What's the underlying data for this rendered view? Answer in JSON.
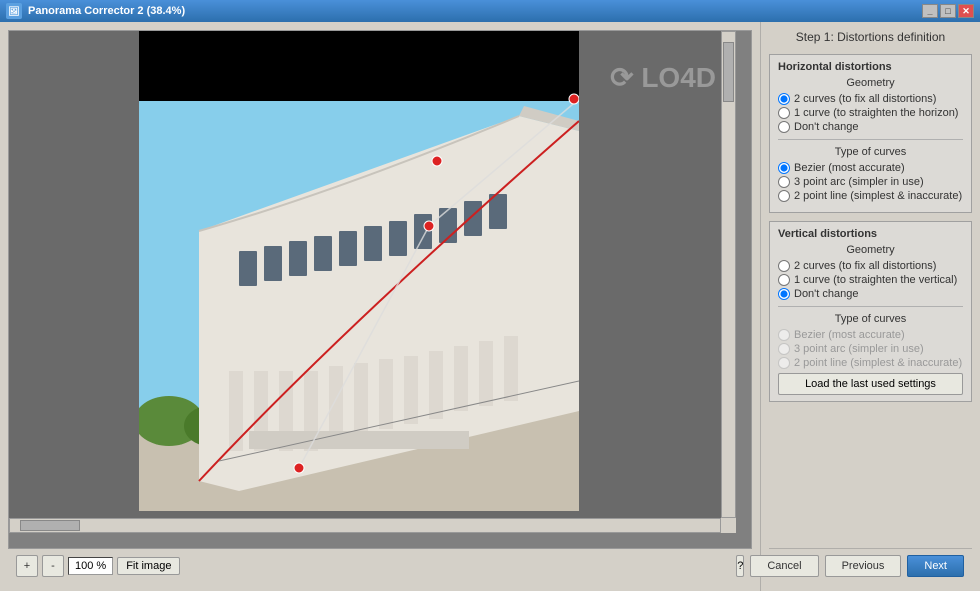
{
  "titleBar": {
    "title": "Panorama Corrector 2 (38.4%)",
    "controls": [
      "minimize",
      "maximize",
      "close"
    ]
  },
  "stepTitle": "Step 1: Distortions definition",
  "horizontalDistortions": {
    "sectionLabel": "Horizontal distortions",
    "geometryLabel": "Geometry",
    "geometryOptions": [
      {
        "id": "h-geo-1",
        "label": "2 curves  (to fix all distortions)",
        "checked": true
      },
      {
        "id": "h-geo-2",
        "label": "1 curve  (to straighten the horizon)",
        "checked": false
      },
      {
        "id": "h-geo-3",
        "label": "Don't change",
        "checked": false
      }
    ],
    "curvesTypeLabel": "Type of curves",
    "curvesOptions": [
      {
        "id": "h-curve-1",
        "label": "Bezier  (most accurate)",
        "checked": true
      },
      {
        "id": "h-curve-2",
        "label": "3 point arc  (simpler in use)",
        "checked": false
      },
      {
        "id": "h-curve-3",
        "label": "2 point line  (simplest & inaccurate)",
        "checked": false
      }
    ]
  },
  "verticalDistortions": {
    "sectionLabel": "Vertical distortions",
    "geometryLabel": "Geometry",
    "geometryOptions": [
      {
        "id": "v-geo-1",
        "label": "2 curves  (to fix all distortions)",
        "checked": false
      },
      {
        "id": "v-geo-2",
        "label": "1 curve  (to straighten the vertical)",
        "checked": false
      },
      {
        "id": "v-geo-3",
        "label": "Don't change",
        "checked": true
      }
    ],
    "curvesTypeLabel": "Type of curves",
    "curvesOptions": [
      {
        "id": "v-curve-1",
        "label": "Bezier  (most accurate)",
        "checked": false,
        "disabled": true
      },
      {
        "id": "v-curve-2",
        "label": "3 point arc  (simpler in use)",
        "checked": false,
        "disabled": true
      },
      {
        "id": "v-curve-3",
        "label": "2 point line  (simplest & inaccurate)",
        "checked": false,
        "disabled": true
      }
    ]
  },
  "loadSettingsBtn": "Load the last used settings",
  "toolbar": {
    "zoomPlus": "+",
    "zoomMinus": "-",
    "zoomLevel": "100 %",
    "fitImage": "Fit image"
  },
  "bottomNav": {
    "helpLabel": "?",
    "previousLabel": "Previous",
    "nextLabel": "Next",
    "cancelLabel": "Cancel"
  }
}
